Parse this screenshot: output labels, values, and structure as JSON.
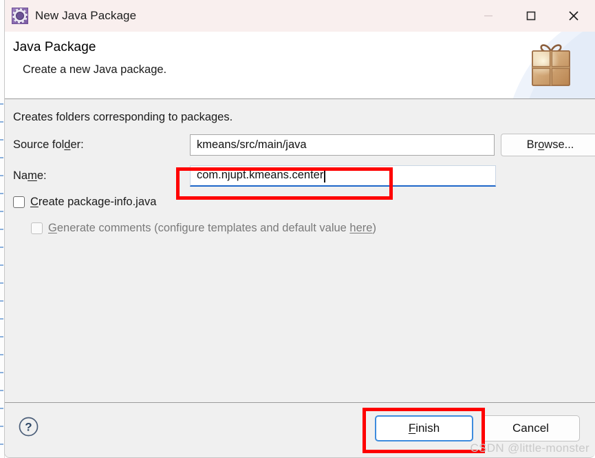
{
  "window": {
    "title": "New Java Package",
    "icon": "java-package-gear-icon",
    "controls": {
      "minimize": "minimize-icon",
      "maximize": "maximize-icon",
      "close": "close-icon"
    }
  },
  "header": {
    "title": "Java Package",
    "subtitle": "Create a new Java package.",
    "banner_icon": "gift-box-icon"
  },
  "body": {
    "note": "Creates folders corresponding to packages.",
    "source_folder": {
      "label_pre": "Source fol",
      "label_mnemonic": "d",
      "label_post": "er:",
      "value": "kmeans/src/main/java",
      "browse_pre": "Br",
      "browse_mnemonic": "o",
      "browse_post": "wse..."
    },
    "name": {
      "label_pre": "Na",
      "label_mnemonic": "m",
      "label_post": "e:",
      "value": "com.njupt.kmeans.center"
    },
    "create_package_info": {
      "mnemonic": "C",
      "label_post": "reate package-info.java",
      "checked": false
    },
    "generate_comments": {
      "mnemonic": "G",
      "label_mid": "enerate comments (configure templates and default value ",
      "link": "here",
      "label_end": ")",
      "checked": false,
      "disabled": true
    }
  },
  "footer": {
    "help_icon": "help-circle-icon",
    "finish_mnemonic": "F",
    "finish_post": "inish",
    "cancel": "Cancel"
  },
  "watermark": "CSDN @little-monster",
  "colors": {
    "titlebar": "#f9efee",
    "body": "#f0f0f0",
    "accent_focus": "#1d66c9",
    "annotation_red": "#fe0000",
    "primary_border": "#3d8bdd",
    "disabled_text": "#7a7a7a",
    "watermark": "#c9c9c9"
  }
}
